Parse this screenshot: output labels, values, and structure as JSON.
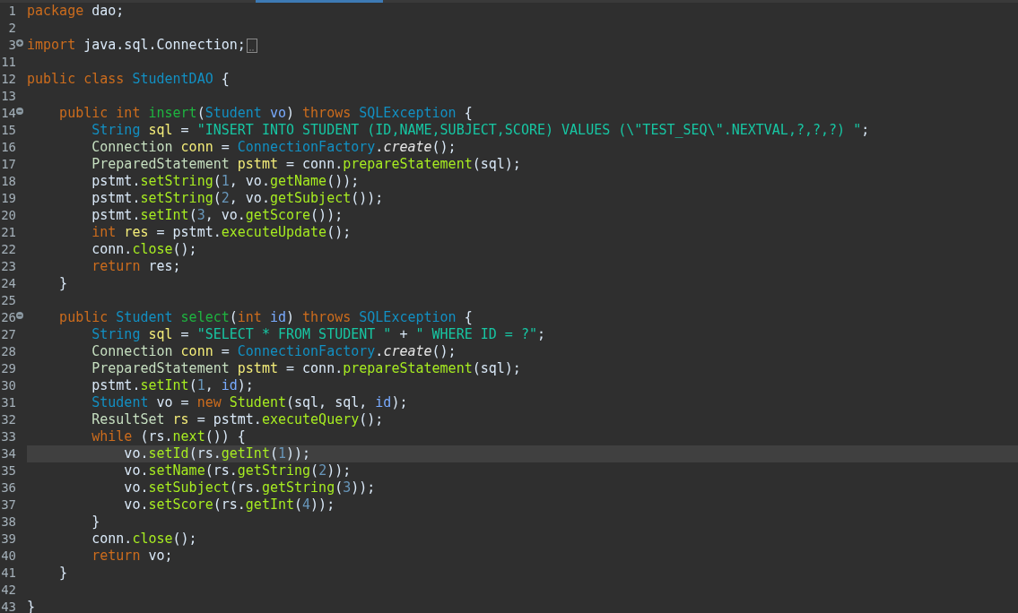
{
  "editor": {
    "lines": [
      {
        "number": "1",
        "current": false,
        "tokens": [
          {
            "kind": "kw",
            "text": "package"
          },
          {
            "kind": "plain",
            "text": " dao;"
          }
        ]
      },
      {
        "number": "2",
        "current": false
      },
      {
        "number": "3",
        "current": false,
        "collapsed": true,
        "tokens": [
          {
            "kind": "kw",
            "text": "import"
          },
          {
            "kind": "plain",
            "text": " java.sql.Connection;"
          }
        ]
      },
      {
        "number": "11",
        "current": false
      },
      {
        "number": "12",
        "current": false,
        "tokens": [
          {
            "kind": "kw",
            "text": "public"
          },
          {
            "kind": "kw",
            "text": " class"
          },
          {
            "kind": "type",
            "text": " StudentDAO"
          },
          {
            "kind": "plain",
            "text": " {"
          }
        ]
      },
      {
        "number": "13",
        "current": false
      },
      {
        "number": "14",
        "current": false,
        "collapsed": false,
        "tokens": [
          {
            "kind": "kw",
            "text": "    public"
          },
          {
            "kind": "kw",
            "text": " int"
          },
          {
            "kind": "decl",
            "text": " insert"
          },
          {
            "kind": "plain",
            "text": "("
          },
          {
            "kind": "type",
            "text": "Student"
          },
          {
            "kind": "param",
            "text": " vo"
          },
          {
            "kind": "plain",
            "text": ") "
          },
          {
            "kind": "kw",
            "text": "throws"
          },
          {
            "kind": "type",
            "text": " SQLException"
          },
          {
            "kind": "plain",
            "text": " {"
          }
        ]
      },
      {
        "number": "15",
        "current": false,
        "tokens": [
          {
            "kind": "type",
            "text": "        String"
          },
          {
            "kind": "var",
            "text": " sql"
          },
          {
            "kind": "plain",
            "text": " = "
          },
          {
            "kind": "str",
            "text": "\"INSERT INTO STUDENT (ID,NAME,SUBJECT,SCORE) VALUES (\\\"TEST_SEQ\\\".NEXTVAL,?,?,?) \""
          },
          {
            "kind": "plain",
            "text": ";"
          }
        ]
      },
      {
        "number": "16",
        "current": false,
        "tokens": [
          {
            "kind": "cls",
            "text": "        Connection"
          },
          {
            "kind": "var",
            "text": " conn"
          },
          {
            "kind": "plain",
            "text": " = "
          },
          {
            "kind": "type",
            "text": "ConnectionFactory"
          },
          {
            "kind": "plain",
            "text": "."
          },
          {
            "kind": "static",
            "text": "create"
          },
          {
            "kind": "plain",
            "text": "();"
          }
        ]
      },
      {
        "number": "17",
        "current": false,
        "tokens": [
          {
            "kind": "cls",
            "text": "        PreparedStatement"
          },
          {
            "kind": "var",
            "text": " pstmt"
          },
          {
            "kind": "plain",
            "text": " = conn."
          },
          {
            "kind": "call",
            "text": "prepareStatement"
          },
          {
            "kind": "plain",
            "text": "(sql);"
          }
        ]
      },
      {
        "number": "18",
        "current": false,
        "tokens": [
          {
            "kind": "plain",
            "text": "        pstmt."
          },
          {
            "kind": "call",
            "text": "setString"
          },
          {
            "kind": "plain",
            "text": "("
          },
          {
            "kind": "num",
            "text": "1"
          },
          {
            "kind": "plain",
            "text": ", vo."
          },
          {
            "kind": "call",
            "text": "getName"
          },
          {
            "kind": "plain",
            "text": "());"
          }
        ]
      },
      {
        "number": "19",
        "current": false,
        "tokens": [
          {
            "kind": "plain",
            "text": "        pstmt."
          },
          {
            "kind": "call",
            "text": "setString"
          },
          {
            "kind": "plain",
            "text": "("
          },
          {
            "kind": "num",
            "text": "2"
          },
          {
            "kind": "plain",
            "text": ", vo."
          },
          {
            "kind": "call",
            "text": "getSubject"
          },
          {
            "kind": "plain",
            "text": "());"
          }
        ]
      },
      {
        "number": "20",
        "current": false,
        "tokens": [
          {
            "kind": "plain",
            "text": "        pstmt."
          },
          {
            "kind": "call",
            "text": "setInt"
          },
          {
            "kind": "plain",
            "text": "("
          },
          {
            "kind": "num",
            "text": "3"
          },
          {
            "kind": "plain",
            "text": ", vo."
          },
          {
            "kind": "call",
            "text": "getScore"
          },
          {
            "kind": "plain",
            "text": "());"
          }
        ]
      },
      {
        "number": "21",
        "current": false,
        "tokens": [
          {
            "kind": "kw",
            "text": "        int"
          },
          {
            "kind": "var",
            "text": " res"
          },
          {
            "kind": "plain",
            "text": " = pstmt."
          },
          {
            "kind": "call",
            "text": "executeUpdate"
          },
          {
            "kind": "plain",
            "text": "();"
          }
        ]
      },
      {
        "number": "22",
        "current": false,
        "tokens": [
          {
            "kind": "plain",
            "text": "        conn."
          },
          {
            "kind": "call",
            "text": "close"
          },
          {
            "kind": "plain",
            "text": "();"
          }
        ]
      },
      {
        "number": "23",
        "current": false,
        "tokens": [
          {
            "kind": "kw",
            "text": "        return"
          },
          {
            "kind": "plain",
            "text": " res;"
          }
        ]
      },
      {
        "number": "24",
        "current": false,
        "tokens": [
          {
            "kind": "plain",
            "text": "    }"
          }
        ]
      },
      {
        "number": "25",
        "current": false
      },
      {
        "number": "26",
        "current": false,
        "collapsed": false,
        "tokens": [
          {
            "kind": "kw",
            "text": "    public"
          },
          {
            "kind": "type",
            "text": " Student"
          },
          {
            "kind": "decl",
            "text": " select"
          },
          {
            "kind": "plain",
            "text": "("
          },
          {
            "kind": "kw",
            "text": "int"
          },
          {
            "kind": "param",
            "text": " id"
          },
          {
            "kind": "plain",
            "text": ") "
          },
          {
            "kind": "kw",
            "text": "throws"
          },
          {
            "kind": "type",
            "text": " SQLException"
          },
          {
            "kind": "plain",
            "text": " {"
          }
        ]
      },
      {
        "number": "27",
        "current": false,
        "tokens": [
          {
            "kind": "type",
            "text": "        String"
          },
          {
            "kind": "var",
            "text": " sql"
          },
          {
            "kind": "plain",
            "text": " = "
          },
          {
            "kind": "str",
            "text": "\"SELECT * FROM STUDENT \""
          },
          {
            "kind": "plain",
            "text": " + "
          },
          {
            "kind": "str",
            "text": "\" WHERE ID = ?\""
          },
          {
            "kind": "plain",
            "text": ";"
          }
        ]
      },
      {
        "number": "28",
        "current": false,
        "tokens": [
          {
            "kind": "cls",
            "text": "        Connection"
          },
          {
            "kind": "var",
            "text": " conn"
          },
          {
            "kind": "plain",
            "text": " = "
          },
          {
            "kind": "type",
            "text": "ConnectionFactory"
          },
          {
            "kind": "plain",
            "text": "."
          },
          {
            "kind": "static",
            "text": "create"
          },
          {
            "kind": "plain",
            "text": "();"
          }
        ]
      },
      {
        "number": "29",
        "current": false,
        "tokens": [
          {
            "kind": "cls",
            "text": "        PreparedStatement"
          },
          {
            "kind": "var",
            "text": " pstmt"
          },
          {
            "kind": "plain",
            "text": " = conn."
          },
          {
            "kind": "call",
            "text": "prepareStatement"
          },
          {
            "kind": "plain",
            "text": "(sql);"
          }
        ]
      },
      {
        "number": "30",
        "current": false,
        "tokens": [
          {
            "kind": "plain",
            "text": "        pstmt."
          },
          {
            "kind": "call",
            "text": "setInt"
          },
          {
            "kind": "plain",
            "text": "("
          },
          {
            "kind": "num",
            "text": "1"
          },
          {
            "kind": "plain",
            "text": ", "
          },
          {
            "kind": "param",
            "text": "id"
          },
          {
            "kind": "plain",
            "text": ");"
          }
        ]
      },
      {
        "number": "31",
        "current": false,
        "tokens": [
          {
            "kind": "type",
            "text": "        Student"
          },
          {
            "kind": "plain",
            "text": " vo = "
          },
          {
            "kind": "kw",
            "text": "new"
          },
          {
            "kind": "call",
            "text": " Student"
          },
          {
            "kind": "plain",
            "text": "(sql, sql, "
          },
          {
            "kind": "param",
            "text": "id"
          },
          {
            "kind": "plain",
            "text": ");"
          }
        ]
      },
      {
        "number": "32",
        "current": false,
        "tokens": [
          {
            "kind": "cls",
            "text": "        ResultSet"
          },
          {
            "kind": "var",
            "text": " rs"
          },
          {
            "kind": "plain",
            "text": " = pstmt."
          },
          {
            "kind": "call",
            "text": "executeQuery"
          },
          {
            "kind": "plain",
            "text": "();"
          }
        ]
      },
      {
        "number": "33",
        "current": false,
        "tokens": [
          {
            "kind": "kw",
            "text": "        while"
          },
          {
            "kind": "plain",
            "text": " (rs."
          },
          {
            "kind": "call",
            "text": "next"
          },
          {
            "kind": "plain",
            "text": "()) {"
          }
        ]
      },
      {
        "number": "34",
        "current": true,
        "tokens": [
          {
            "kind": "plain",
            "text": "            vo."
          },
          {
            "kind": "call",
            "text": "setId"
          },
          {
            "kind": "plain",
            "text": "(rs."
          },
          {
            "kind": "call",
            "text": "getInt"
          },
          {
            "kind": "plain",
            "text": "("
          },
          {
            "kind": "num",
            "text": "1"
          },
          {
            "kind": "plain",
            "text": "));"
          }
        ]
      },
      {
        "number": "35",
        "current": false,
        "tokens": [
          {
            "kind": "plain",
            "text": "            vo."
          },
          {
            "kind": "call",
            "text": "setName"
          },
          {
            "kind": "plain",
            "text": "(rs."
          },
          {
            "kind": "call",
            "text": "getString"
          },
          {
            "kind": "plain",
            "text": "("
          },
          {
            "kind": "num",
            "text": "2"
          },
          {
            "kind": "plain",
            "text": "));"
          }
        ]
      },
      {
        "number": "36",
        "current": false,
        "tokens": [
          {
            "kind": "plain",
            "text": "            vo."
          },
          {
            "kind": "call",
            "text": "setSubject"
          },
          {
            "kind": "plain",
            "text": "(rs."
          },
          {
            "kind": "call",
            "text": "getString"
          },
          {
            "kind": "plain",
            "text": "("
          },
          {
            "kind": "num",
            "text": "3"
          },
          {
            "kind": "plain",
            "text": "));"
          }
        ]
      },
      {
        "number": "37",
        "current": false,
        "tokens": [
          {
            "kind": "plain",
            "text": "            vo."
          },
          {
            "kind": "call",
            "text": "setScore"
          },
          {
            "kind": "plain",
            "text": "(rs."
          },
          {
            "kind": "call",
            "text": "getInt"
          },
          {
            "kind": "plain",
            "text": "("
          },
          {
            "kind": "num",
            "text": "4"
          },
          {
            "kind": "plain",
            "text": "));"
          }
        ]
      },
      {
        "number": "38",
        "current": false,
        "tokens": [
          {
            "kind": "plain",
            "text": "        }"
          }
        ]
      },
      {
        "number": "39",
        "current": false,
        "tokens": [
          {
            "kind": "plain",
            "text": "        conn."
          },
          {
            "kind": "call",
            "text": "close"
          },
          {
            "kind": "plain",
            "text": "();"
          }
        ]
      },
      {
        "number": "40",
        "current": false,
        "tokens": [
          {
            "kind": "kw",
            "text": "        return"
          },
          {
            "kind": "plain",
            "text": " vo;"
          }
        ]
      },
      {
        "number": "41",
        "current": false,
        "tokens": [
          {
            "kind": "plain",
            "text": "    }"
          }
        ]
      },
      {
        "number": "42",
        "current": false
      },
      {
        "number": "43",
        "current": false,
        "tokens": [
          {
            "kind": "plain",
            "text": "}"
          }
        ]
      }
    ]
  }
}
